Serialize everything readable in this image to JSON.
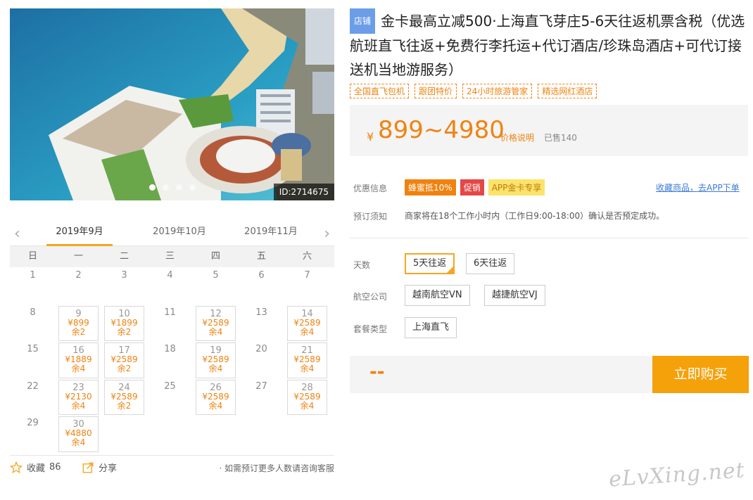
{
  "hero": {
    "id_tag": "ID:2714675",
    "slide_count": 4,
    "active_slide": 1
  },
  "calendar": {
    "months": [
      "2019年9月",
      "2019年10月",
      "2019年11月"
    ],
    "active_month": 0,
    "weekdays": [
      "日",
      "一",
      "二",
      "三",
      "四",
      "五",
      "六"
    ],
    "cells": [
      {
        "day": "1"
      },
      {
        "day": "2"
      },
      {
        "day": "3"
      },
      {
        "day": "4"
      },
      {
        "day": "5"
      },
      {
        "day": "6"
      },
      {
        "day": "7"
      },
      {
        "day": "8"
      },
      {
        "day": "9",
        "price": "¥899",
        "stock": "余2"
      },
      {
        "day": "10",
        "price": "¥1899",
        "stock": "余2"
      },
      {
        "day": "11"
      },
      {
        "day": "12",
        "price": "¥2589",
        "stock": "余4"
      },
      {
        "day": "13"
      },
      {
        "day": "14",
        "price": "¥2589",
        "stock": "余4"
      },
      {
        "day": "15"
      },
      {
        "day": "16",
        "price": "¥1889",
        "stock": "余4"
      },
      {
        "day": "17",
        "price": "¥2589",
        "stock": "余2"
      },
      {
        "day": "18"
      },
      {
        "day": "19",
        "price": "¥2589",
        "stock": "余4"
      },
      {
        "day": "20"
      },
      {
        "day": "21",
        "price": "¥2589",
        "stock": "余4"
      },
      {
        "day": "22"
      },
      {
        "day": "23",
        "price": "¥2130",
        "stock": "余4"
      },
      {
        "day": "24",
        "price": "¥2589",
        "stock": "余2"
      },
      {
        "day": "25"
      },
      {
        "day": "26",
        "price": "¥2589",
        "stock": "余4"
      },
      {
        "day": "27"
      },
      {
        "day": "28",
        "price": "¥2589",
        "stock": "余4"
      },
      {
        "day": "29"
      },
      {
        "day": "30",
        "price": "¥4880",
        "stock": "余4"
      }
    ]
  },
  "footer": {
    "favorite_label": "收藏",
    "favorite_count": "86",
    "share_label": "分享",
    "consult_text": "· 如需预订更多人数请咨询客服"
  },
  "product": {
    "shop_badge": "店铺",
    "title": "金卡最高立减500·上海直飞芽庄5-6天往返机票含税（优选航班直飞往返+免费行李托运+代订酒店/珍珠岛酒店+可代订接送机当地游服务）",
    "tags": [
      "全国直飞包机",
      "跟团特价",
      "24小时旅游管家",
      "精选网红酒店"
    ]
  },
  "price": {
    "currency": "¥",
    "range": "899~4980",
    "explain_label": "价格说明",
    "sold_label": "已售140"
  },
  "promo": {
    "label": "优惠信息",
    "badges": [
      "蜂蜜抵10%",
      "促销",
      "APP金卡专享"
    ],
    "app_link": "收藏商品，去APP下单"
  },
  "notice": {
    "label": "预订须知",
    "text": "商家将在18个工作小时内（工作日9:00-18:00）确认是否预定成功。"
  },
  "options": {
    "days_label": "天数",
    "days": [
      "5天往返",
      "6天往返"
    ],
    "airline_label": "航空公司",
    "airlines": [
      "越南航空VN",
      "越捷航空VJ"
    ],
    "package_label": "套餐类型",
    "packages": [
      "上海直飞"
    ]
  },
  "buy": {
    "total": "--",
    "button_label": "立即购买"
  },
  "watermark": "eLvXing.net",
  "colors": {
    "accent_orange": "#f08210",
    "buy_button": "#f5a10a",
    "shop_badge": "#6b9de8",
    "link_blue": "#3d7bd9"
  }
}
